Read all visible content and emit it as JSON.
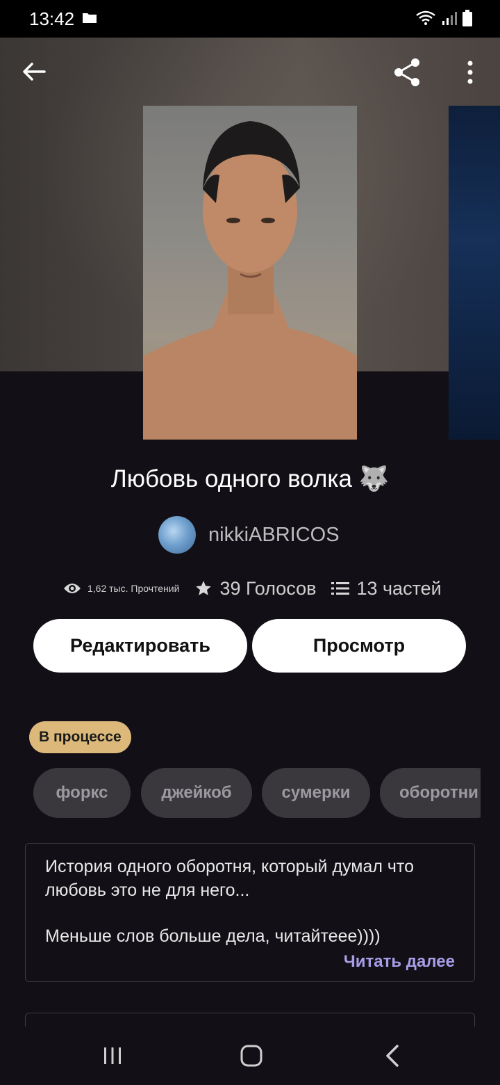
{
  "status_bar": {
    "time": "13:42"
  },
  "story": {
    "title": "Любовь одного волка 🐺",
    "author": "nikkiABRICOS",
    "stats": {
      "reads": "1,62 тыс. Прочтений",
      "votes": "39 Голосов",
      "parts": "13 частей"
    }
  },
  "actions": {
    "edit_label": "Редактировать",
    "preview_label": "Просмотр"
  },
  "status_badge": "В процессе",
  "tags": [
    "форкс",
    "джейкоб",
    "сумерки",
    "оборотни"
  ],
  "description": {
    "line1": "История одного оборотня, который думал что любовь это не для него...",
    "line2": "Меньше слов больше дела, читайтеее))))",
    "read_more": "Читать далее"
  },
  "colors": {
    "background": "#121016",
    "status_pill": "#dcb97b",
    "tag_bg": "#3a383c",
    "read_more": "#a89ee8"
  }
}
